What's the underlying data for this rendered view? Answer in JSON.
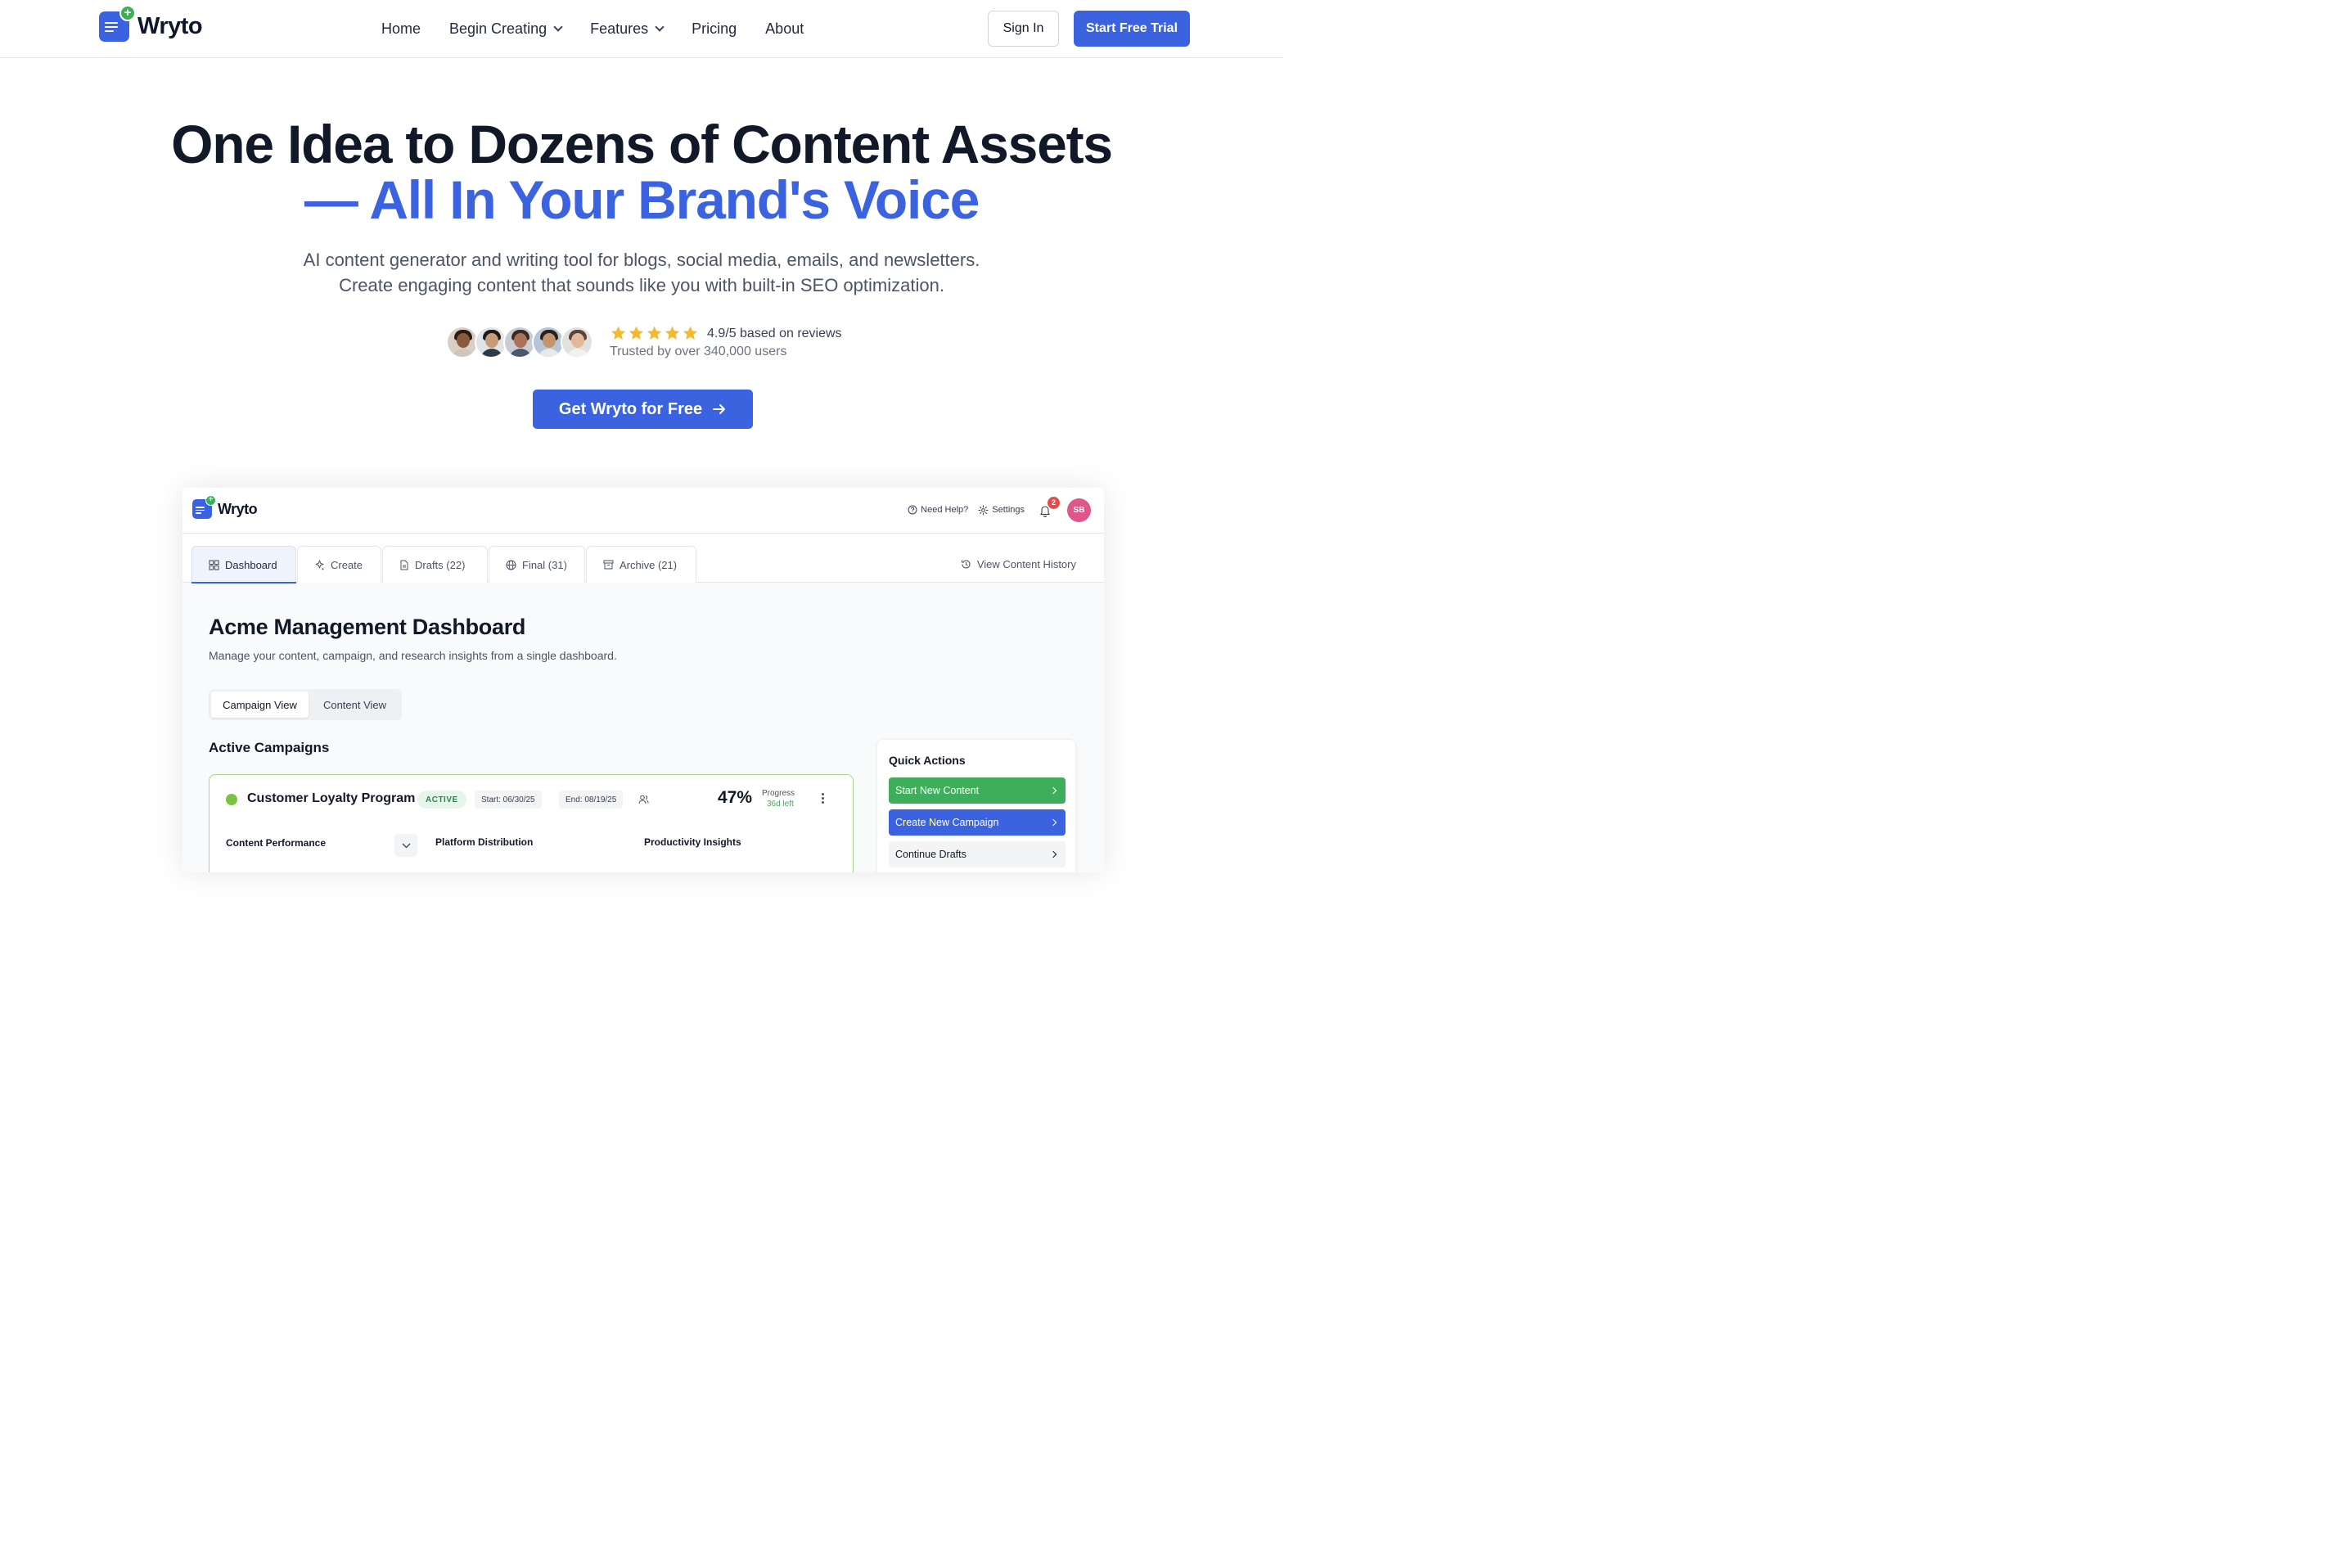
{
  "brand": {
    "name": "Wryto"
  },
  "nav": {
    "links": [
      {
        "label": "Home"
      },
      {
        "label": "Begin Creating"
      },
      {
        "label": "Features"
      },
      {
        "label": "Pricing"
      },
      {
        "label": "About"
      }
    ],
    "sign_in": "Sign In",
    "start_trial": "Start Free Trial"
  },
  "hero": {
    "headline_1": "One Idea to Dozens of Content Assets",
    "headline_2": "— All In Your Brand's Voice",
    "sub_1": "AI content generator and writing tool for blogs, social media, emails, and newsletters.",
    "sub_2": "Create engaging content that sounds like you with built-in SEO optimization.",
    "rating_text": "4.9/5 based on reviews",
    "rating_stars": 5,
    "trusted_text": "Trusted by over 340,000 users",
    "cta": "Get Wryto for Free"
  },
  "app": {
    "brand": "Wryto",
    "header": {
      "help": "Need Help?",
      "settings": "Settings",
      "notification_count": "2",
      "user_initials": "SB"
    },
    "tabs": [
      {
        "label": "Dashboard",
        "icon": "dashboard-icon"
      },
      {
        "label": "Create",
        "icon": "sparkle-icon"
      },
      {
        "label": "Drafts (22)",
        "icon": "document-icon"
      },
      {
        "label": "Final (31)",
        "icon": "globe-icon"
      },
      {
        "label": "Archive (21)",
        "icon": "archive-icon"
      }
    ],
    "history_link": "View Content History",
    "dashboard": {
      "title": "Acme Management Dashboard",
      "subtitle": "Manage your content, campaign, and research insights from a single dashboard.",
      "views": [
        "Campaign View",
        "Content View"
      ],
      "active_campaigns_title": "Active Campaigns",
      "campaign": {
        "name": "Customer Loyalty Program",
        "status": "ACTIVE",
        "start": "Start: 06/30/25",
        "end": "End: 08/19/25",
        "progress_pct": "47%",
        "progress_label": "Progress",
        "days_left": "36d left",
        "columns": [
          "Content Performance",
          "Platform Distribution",
          "Productivity Insights"
        ]
      },
      "quick_actions": {
        "title": "Quick Actions",
        "items": [
          "Start New Content",
          "Create New Campaign",
          "Continue Drafts"
        ]
      }
    }
  },
  "colors": {
    "primary": "#3b63e0",
    "success": "#3fae5a",
    "text": "#111827",
    "muted": "#4b5563",
    "star": "#f5b92e",
    "badge_red": "#e24c4c",
    "avatar_pink": "#e0558a"
  }
}
